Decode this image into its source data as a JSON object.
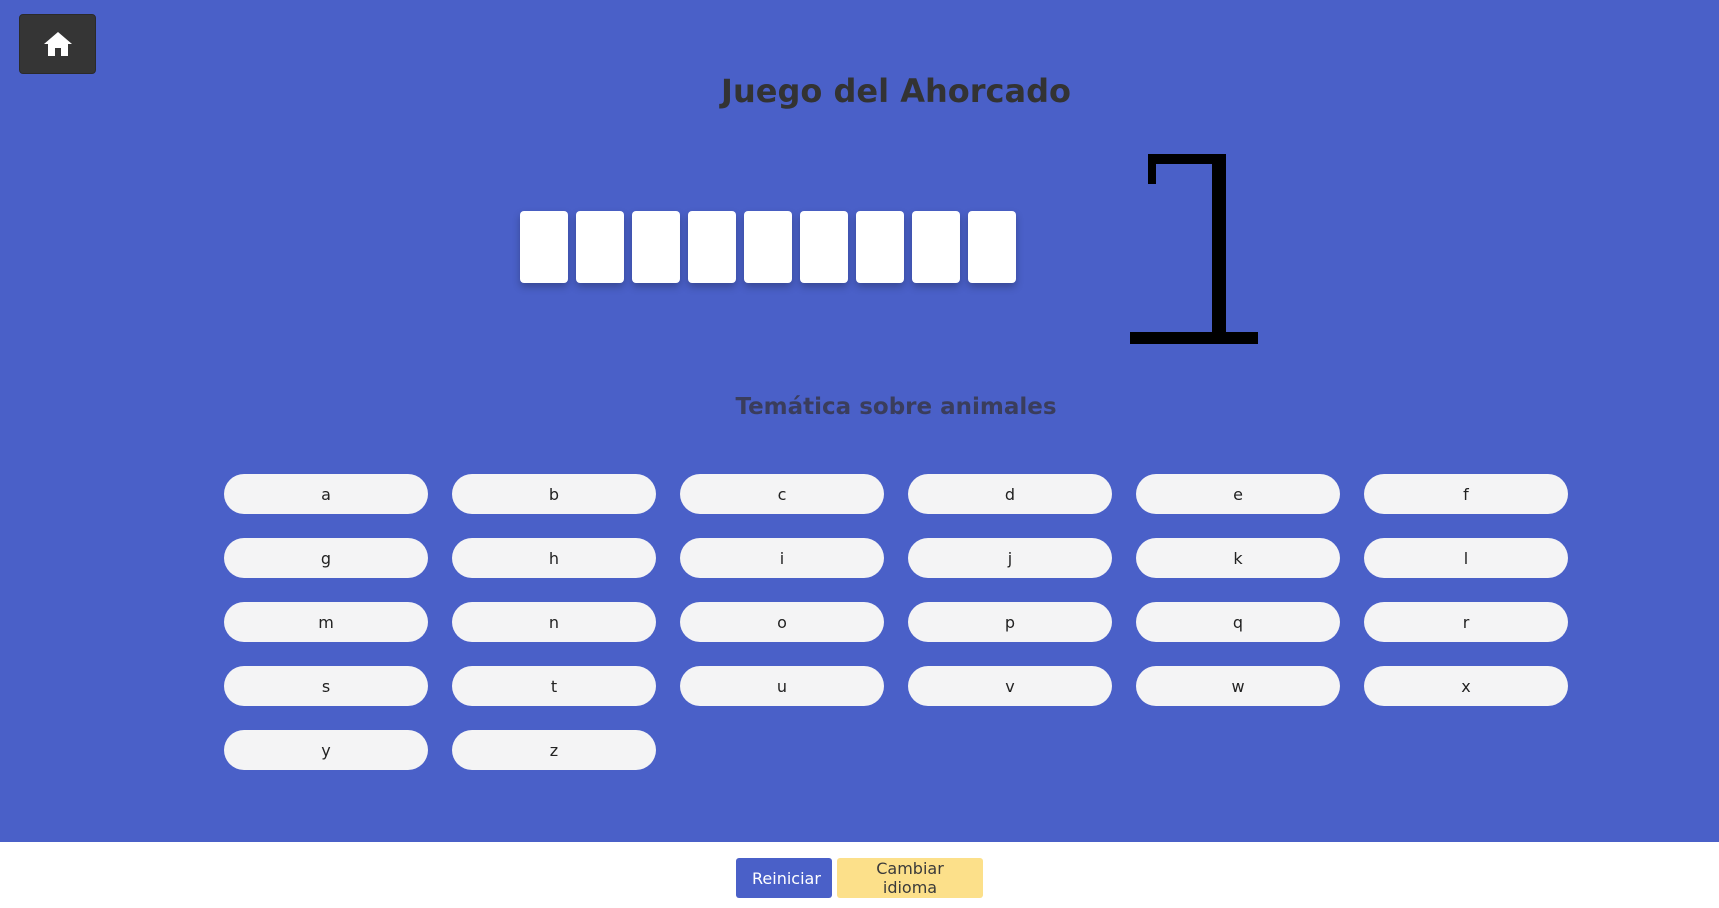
{
  "header": {
    "home_icon": "home-icon"
  },
  "game": {
    "title": "Juego del Ahorcado",
    "word_length": 9,
    "theme": "Temática sobre animales"
  },
  "keyboard": {
    "letters": [
      "a",
      "b",
      "c",
      "d",
      "e",
      "f",
      "g",
      "h",
      "i",
      "j",
      "k",
      "l",
      "m",
      "n",
      "o",
      "p",
      "q",
      "r",
      "s",
      "t",
      "u",
      "v",
      "w",
      "x",
      "y",
      "z"
    ]
  },
  "footer": {
    "restart_label": "Reiniciar",
    "language_label": "Cambiar idioma"
  },
  "colors": {
    "background": "#4a60c8",
    "key_bg": "#f4f4f5",
    "restart_bg": "#4a60c8",
    "language_bg": "#fce08a",
    "home_bg": "#353535"
  }
}
